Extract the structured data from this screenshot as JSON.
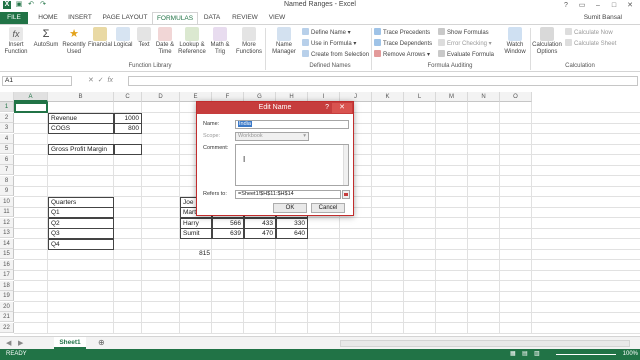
{
  "window": {
    "title": "Named Ranges - Excel"
  },
  "tabs": {
    "file": "FILE",
    "home": "HOME",
    "insert": "INSERT",
    "page_layout": "PAGE LAYOUT",
    "formulas": "FORMULAS",
    "data": "DATA",
    "review": "REVIEW",
    "view": "VIEW"
  },
  "user": {
    "name": "Sumit Bansal"
  },
  "ribbon": {
    "insert_function": "Insert Function",
    "autosum": "AutoSum",
    "recently_used": "Recently Used",
    "financial": "Financial",
    "logical": "Logical",
    "text": "Text",
    "date_time": "Date & Time",
    "lookup_reference": "Lookup & Reference",
    "math_trig": "Math & Trig",
    "more_functions": "More Functions",
    "function_library_label": "Function Library",
    "name_manager": "Name Manager",
    "define_name": "Define Name",
    "use_in_formula": "Use in Formula",
    "create_from_selection": "Create from Selection",
    "defined_names_label": "Defined Names",
    "trace_precedents": "Trace Precedents",
    "trace_dependents": "Trace Dependents",
    "remove_arrows": "Remove Arrows",
    "show_formulas": "Show Formulas",
    "error_checking": "Error Checking",
    "evaluate_formula": "Evaluate Formula",
    "watch_window": "Watch Window",
    "formula_auditing_label": "Formula Auditing",
    "calculation_options": "Calculation Options",
    "calculate_now": "Calculate Now",
    "calculate_sheet": "Calculate Sheet",
    "calculation_label": "Calculation"
  },
  "formula_bar": {
    "name_box": "A1",
    "fx": "fx",
    "content": ""
  },
  "grid": {
    "columns": [
      "A",
      "B",
      "C",
      "D",
      "E",
      "F",
      "G",
      "H",
      "I",
      "J",
      "K",
      "L",
      "M",
      "N",
      "O"
    ],
    "rows": [
      "1",
      "2",
      "3",
      "4",
      "5",
      "6",
      "7",
      "8",
      "9",
      "10",
      "11",
      "12",
      "13",
      "14",
      "15",
      "16",
      "17",
      "18",
      "19",
      "20",
      "21",
      "22"
    ],
    "cells": {
      "b2": "Revenue",
      "c2": "1000",
      "b3": "COGS",
      "c3": "800",
      "b5": "Gross Profit Margin",
      "b10": "Quarters",
      "b11": "Q1",
      "b12": "Q2",
      "b13": "Q3",
      "b14": "Q4",
      "e2": "16",
      "e10": "Joe",
      "e11": "Martha",
      "e12": "Harry",
      "f12": "566",
      "g12": "433",
      "h12": "330",
      "e13": "Sumit",
      "f13": "639",
      "g13": "470",
      "h13": "640",
      "e15": "815"
    }
  },
  "dialog": {
    "title": "Edit Name",
    "help": "?",
    "close": "✕",
    "name_label": "Name:",
    "name_value": "India",
    "scope_label": "Scope:",
    "scope_value": "Workbook",
    "comment_label": "Comment:",
    "refers_label": "Refers to:",
    "refers_value": "=Sheet1!$H$11:$H$14",
    "ok": "OK",
    "cancel": "Cancel"
  },
  "sheets": {
    "active": "Sheet1"
  },
  "status": {
    "mode": "READY",
    "zoom": "100%"
  }
}
